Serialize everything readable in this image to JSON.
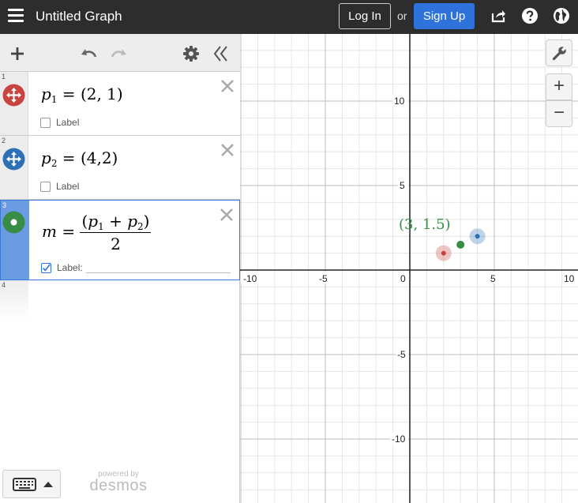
{
  "app": {
    "title": "Untitled Graph",
    "login_label": "Log In",
    "or_label": "or",
    "signup_label": "Sign Up"
  },
  "icons": {
    "menu": "hamburger-icon",
    "share": "share-icon",
    "help": "help-icon",
    "language": "globe-icon",
    "add": "plus-icon",
    "undo": "undo-icon",
    "redo": "redo-icon",
    "settings": "gear-icon",
    "collapse": "double-chevron-left-icon",
    "delete": "close-icon",
    "keyboard": "keyboard-icon",
    "wrench": "wrench-icon",
    "zoom_in": "plus-icon",
    "zoom_out": "minus-icon"
  },
  "colors": {
    "accent": "#2f72dc",
    "red": "#c74440",
    "blue": "#2d70b3",
    "green": "#388c46"
  },
  "expressions": [
    {
      "number": "1",
      "lhs": "p",
      "sub": "1",
      "rhs": "(2, 1)",
      "label_text": "Label",
      "label_checked": false,
      "color": "#c74440"
    },
    {
      "number": "2",
      "lhs": "p",
      "sub": "2",
      "rhs": "(4,2)",
      "label_text": "Label",
      "label_checked": false,
      "color": "#2d70b3"
    },
    {
      "number": "3",
      "lhs": "m",
      "num_a": "p",
      "num_a_sub": "1",
      "plus": "+",
      "num_b": "p",
      "num_b_sub": "2",
      "den": "2",
      "label_text": "Label:",
      "label_checked": true,
      "color": "#388c46"
    },
    {
      "number": "4"
    }
  ],
  "branding": {
    "powered_by": "powered by",
    "logo": "desmos"
  },
  "graph": {
    "x_ticks": [
      "-10",
      "-5",
      "0",
      "5",
      "10"
    ],
    "y_ticks": [
      "10",
      "5",
      "-5",
      "-10"
    ],
    "zoom_in_label": "+",
    "zoom_out_label": "−",
    "point_label": "(3, 1.5)",
    "points": [
      {
        "x": 2,
        "y": 1,
        "color": "#c74440",
        "halo": true
      },
      {
        "x": 4,
        "y": 2,
        "color": "#2d70b3",
        "halo": true
      },
      {
        "x": 3,
        "y": 1.5,
        "color": "#388c46",
        "halo": false
      }
    ]
  }
}
